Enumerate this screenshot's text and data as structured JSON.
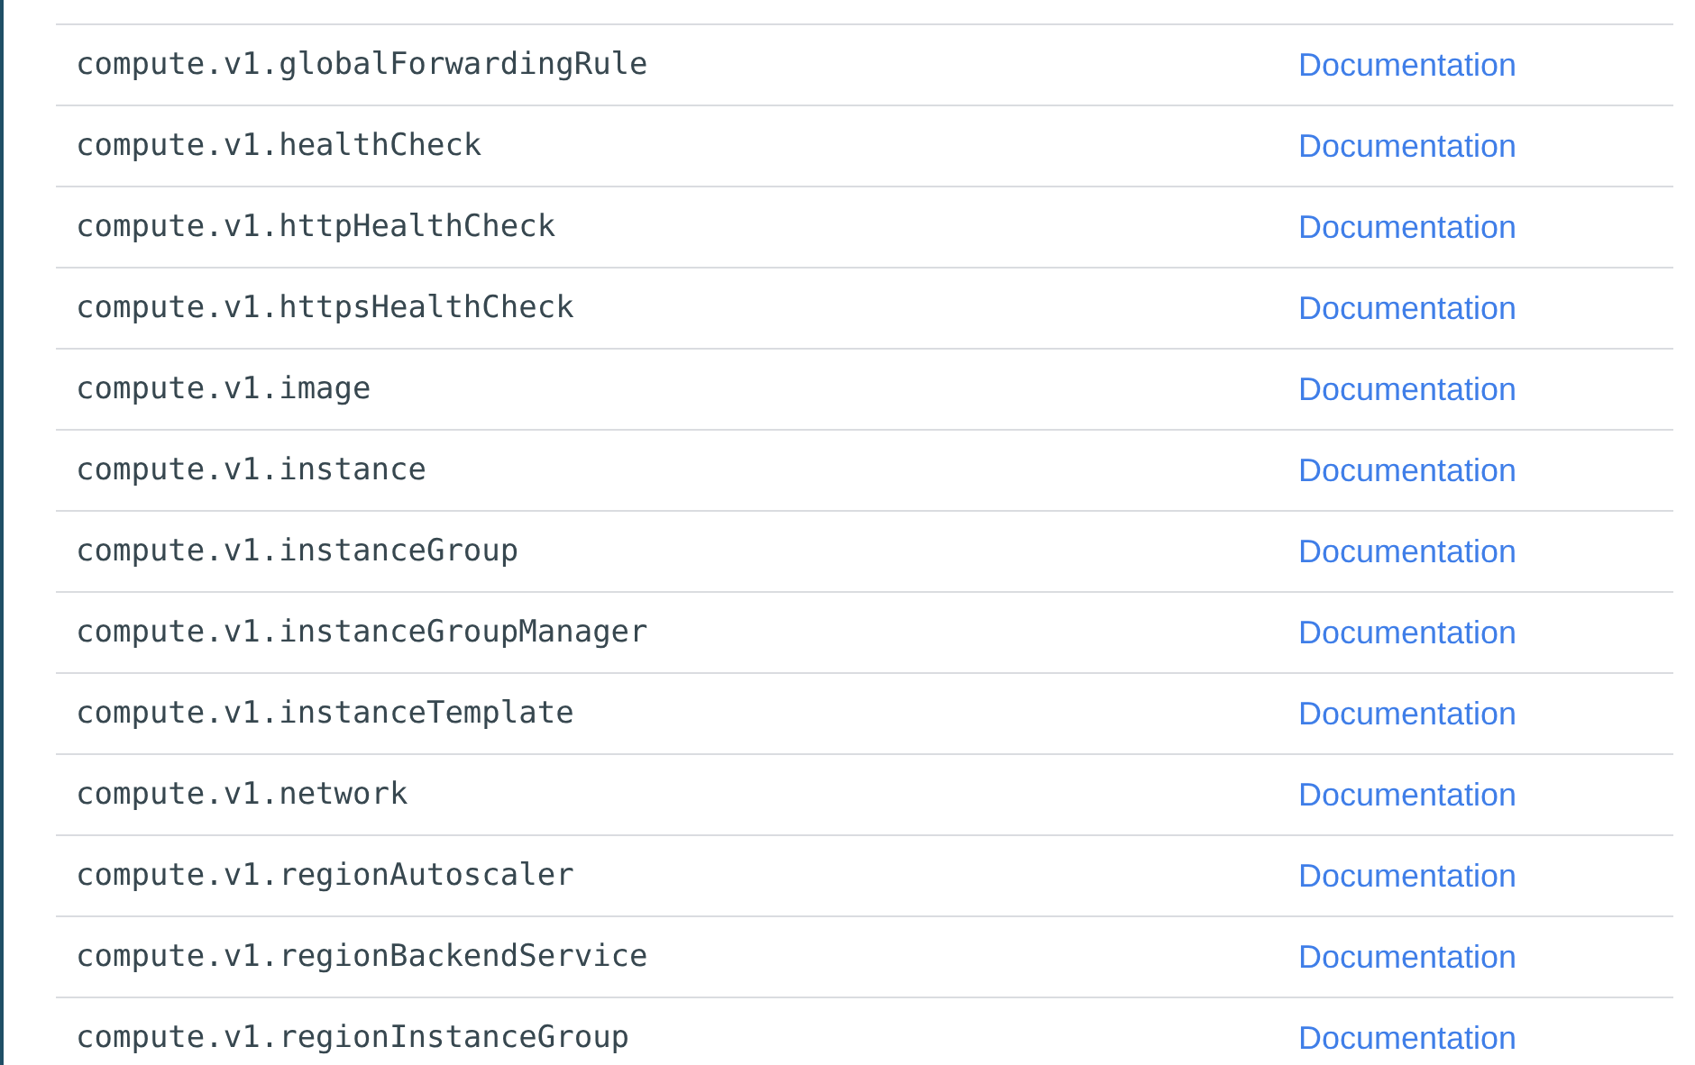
{
  "rows": [
    {
      "type": "compute.v1.globalForwardingRule",
      "link": "Documentation"
    },
    {
      "type": "compute.v1.healthCheck",
      "link": "Documentation"
    },
    {
      "type": "compute.v1.httpHealthCheck",
      "link": "Documentation"
    },
    {
      "type": "compute.v1.httpsHealthCheck",
      "link": "Documentation"
    },
    {
      "type": "compute.v1.image",
      "link": "Documentation"
    },
    {
      "type": "compute.v1.instance",
      "link": "Documentation"
    },
    {
      "type": "compute.v1.instanceGroup",
      "link": "Documentation"
    },
    {
      "type": "compute.v1.instanceGroupManager",
      "link": "Documentation"
    },
    {
      "type": "compute.v1.instanceTemplate",
      "link": "Documentation"
    },
    {
      "type": "compute.v1.network",
      "link": "Documentation"
    },
    {
      "type": "compute.v1.regionAutoscaler",
      "link": "Documentation"
    },
    {
      "type": "compute.v1.regionBackendService",
      "link": "Documentation"
    },
    {
      "type": "compute.v1.regionInstanceGroup",
      "link": "Documentation"
    }
  ]
}
